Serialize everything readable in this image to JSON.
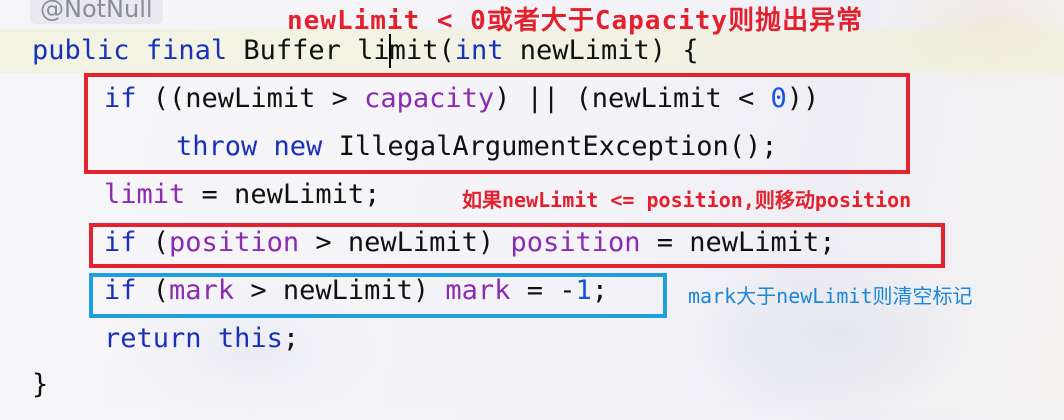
{
  "annotation_chip": "@NotNull",
  "title_note": "newLimit < 0或者大于Capacity则抛出异常",
  "code": {
    "line1": [
      "public",
      "final",
      "Buffer",
      "limit",
      "(",
      "int",
      "newLimit) {"
    ],
    "line2": [
      "if",
      "((newLimit >",
      "capacity",
      ") || (newLimit <",
      "0",
      "))"
    ],
    "line3": [
      "throw",
      "new",
      "IllegalArgumentException();"
    ],
    "line4": [
      "limit",
      "= newLimit;"
    ],
    "line5": [
      "if",
      "(",
      "position",
      "> newLimit)",
      "position",
      "= newLimit;"
    ],
    "line6": [
      "if",
      "(",
      "mark",
      "> newLimit)",
      "mark",
      "= -",
      "1",
      ";"
    ],
    "line7": [
      "return",
      "this",
      ";"
    ],
    "line8": [
      "}"
    ]
  },
  "notes": {
    "position_note": "如果newLimit <= position,则移动position",
    "mark_note": "mark大于newLimit则清空标记"
  },
  "colors": {
    "keyword": "#1a30b8",
    "field": "#8a2bb0",
    "number": "#1750eb",
    "red_box": "#e3232f",
    "blue_box": "#1f9ee0"
  }
}
